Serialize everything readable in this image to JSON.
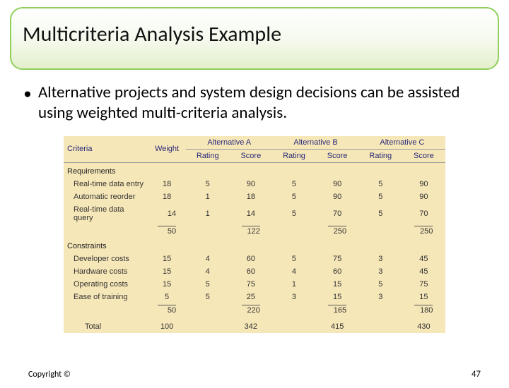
{
  "title": "Multicriteria Analysis Example",
  "bullet": "Alternative projects and system design decisions can be assisted using weighted multi-criteria analysis.",
  "headers": {
    "criteria": "Criteria",
    "weight": "Weight",
    "altA": "Alternative A",
    "altB": "Alternative B",
    "altC": "Alternative C",
    "rating": "Rating",
    "score": "Score"
  },
  "sections": {
    "requirements": "Requirements",
    "constraints": "Constraints"
  },
  "chart_data": {
    "type": "table",
    "title": "Weighted multi-criteria analysis",
    "alternatives": [
      "Alternative A",
      "Alternative B",
      "Alternative C"
    ],
    "groups": [
      {
        "name": "Requirements",
        "rows": [
          {
            "criteria": "Real-time data entry",
            "weight": 18,
            "A": {
              "rating": 5,
              "score": 90
            },
            "B": {
              "rating": 5,
              "score": 90
            },
            "C": {
              "rating": 5,
              "score": 90
            }
          },
          {
            "criteria": "Automatic reorder",
            "weight": 18,
            "A": {
              "rating": 1,
              "score": 18
            },
            "B": {
              "rating": 5,
              "score": 90
            },
            "C": {
              "rating": 5,
              "score": 90
            }
          },
          {
            "criteria": "Real-time data query",
            "weight": 14,
            "A": {
              "rating": 1,
              "score": 14
            },
            "B": {
              "rating": 5,
              "score": 70
            },
            "C": {
              "rating": 5,
              "score": 70
            }
          }
        ],
        "subtotal": {
          "weight": 50,
          "A_score": 122,
          "B_score": 250,
          "C_score": 250
        }
      },
      {
        "name": "Constraints",
        "rows": [
          {
            "criteria": "Developer costs",
            "weight": 15,
            "A": {
              "rating": 4,
              "score": 60
            },
            "B": {
              "rating": 5,
              "score": 75
            },
            "C": {
              "rating": 3,
              "score": 45
            }
          },
          {
            "criteria": "Hardware costs",
            "weight": 15,
            "A": {
              "rating": 4,
              "score": 60
            },
            "B": {
              "rating": 4,
              "score": 60
            },
            "C": {
              "rating": 3,
              "score": 45
            }
          },
          {
            "criteria": "Operating costs",
            "weight": 15,
            "A": {
              "rating": 5,
              "score": 75
            },
            "B": {
              "rating": 1,
              "score": 15
            },
            "C": {
              "rating": 5,
              "score": 75
            }
          },
          {
            "criteria": "Ease of training",
            "weight": 5,
            "A": {
              "rating": 5,
              "score": 25
            },
            "B": {
              "rating": 3,
              "score": 15
            },
            "C": {
              "rating": 3,
              "score": 15
            }
          }
        ],
        "subtotal": {
          "weight": 50,
          "A_score": 220,
          "B_score": 165,
          "C_score": 180
        }
      }
    ],
    "total": {
      "label": "Total",
      "weight": 100,
      "A_score": 342,
      "B_score": 415,
      "C_score": 430
    }
  },
  "footer": {
    "copyright": "Copyright ©",
    "page": "47"
  }
}
